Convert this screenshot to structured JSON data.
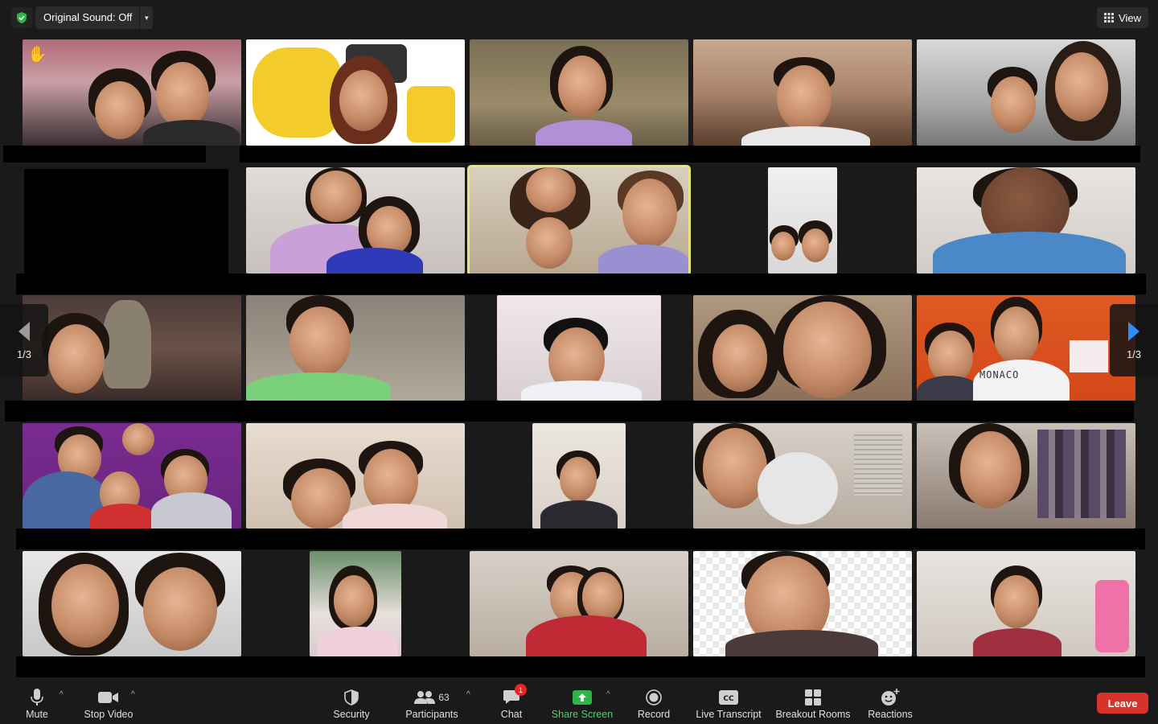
{
  "topbar": {
    "original_sound_label": "Original Sound: Off",
    "view_label": "View"
  },
  "pager": {
    "left_label": "1/3",
    "right_label": "1/3"
  },
  "toolbar": {
    "mute_label": "Mute",
    "stop_video_label": "Stop Video",
    "security_label": "Security",
    "participants_label": "Participants",
    "participants_count": "63",
    "chat_label": "Chat",
    "chat_badge": "1",
    "share_screen_label": "Share Screen",
    "record_label": "Record",
    "live_transcript_label": "Live Transcript",
    "breakout_rooms_label": "Breakout Rooms",
    "reactions_label": "Reactions",
    "leave_label": "Leave"
  },
  "tile_shirt_text": "MONACO",
  "colors": {
    "background": "#1a1a1a",
    "leave": "#d8332b",
    "share_green": "#4fd36b",
    "active_speaker": "#e6e67a",
    "pager_arrow": "#2d8cff",
    "shield_green": "#2fb34a"
  }
}
